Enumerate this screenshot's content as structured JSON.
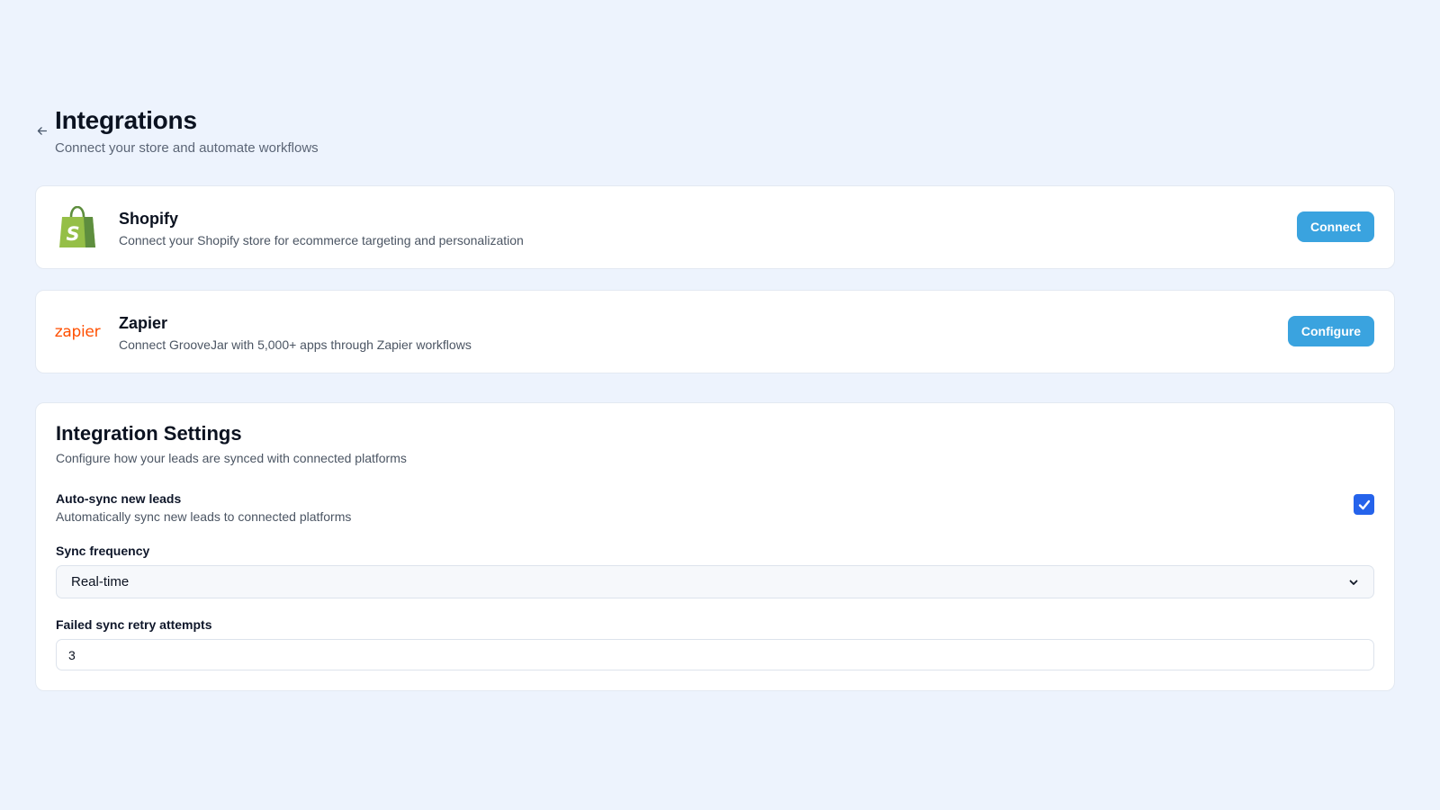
{
  "header": {
    "title": "Integrations",
    "subtitle": "Connect your store and automate workflows",
    "back_icon": "arrow-left-icon"
  },
  "integrations": [
    {
      "name": "Shopify",
      "description": "Connect your Shopify store for ecommerce targeting and personalization",
      "button_label": "Connect",
      "logo": "shopify-bag-icon",
      "logo_letter": "S",
      "logo_color": "#95bf47"
    },
    {
      "name": "Zapier",
      "description": "Connect GrooveJar with 5,000+ apps through Zapier workflows",
      "button_label": "Configure",
      "logo": "zapier-logo",
      "logo_text": "zapier",
      "logo_color": "#ff4f00"
    }
  ],
  "settings": {
    "title": "Integration Settings",
    "subtitle": "Configure how your leads are synced with connected platforms",
    "auto_sync": {
      "label": "Auto-sync new leads",
      "description": "Automatically sync new leads to connected platforms",
      "checked": true
    },
    "sync_frequency": {
      "label": "Sync frequency",
      "value": "Real-time"
    },
    "retry_attempts": {
      "label": "Failed sync retry attempts",
      "value": "3"
    }
  },
  "colors": {
    "background": "#edf3fd",
    "button": "#3aa3df",
    "checkbox": "#2563eb"
  }
}
